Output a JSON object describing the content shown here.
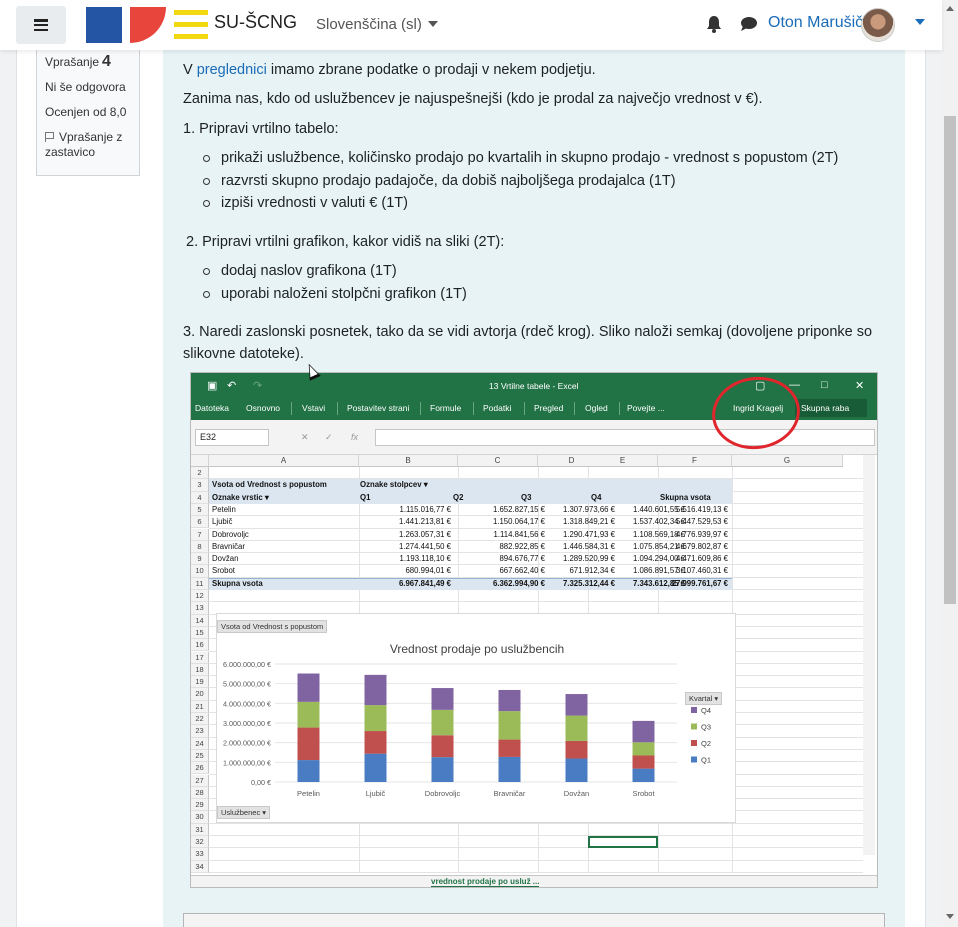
{
  "navbar": {
    "site_name": "SU-ŠCNG",
    "language": "Slovenščina (sl)",
    "user_name": "Oton Marušič"
  },
  "question_info": {
    "label": "Vprašanje",
    "number": "4",
    "status": "Ni še odgovora",
    "grade": "Ocenjen od 8,0",
    "flag_label": "Vprašanje z zastavico"
  },
  "question": {
    "intro_before_link": "V ",
    "intro_link": "preglednici",
    "intro_after_link": " imamo zbrane podatke o prodaji v nekem podjetju.",
    "line2": "Zanima nas, kdo od uslužbencev je najuspešnejši (kdo je prodal za največjo vrednost v €).",
    "task1": "1. Pripravi vrtilno tabelo:",
    "task1_items": [
      "prikaži uslužbence, količinsko prodajo po kvartalih in skupno prodajo - vrednost s popustom (2T)",
      "razvrsti skupno prodajo padajoče, da dobiš najboljšega prodajalca (1T)",
      "izpiši vrednosti v valuti € (1T)"
    ],
    "task2": "2. Pripravi vrtilni grafikon, kakor vidiš na sliki (2T):",
    "task2_items": [
      "dodaj naslov grafikona (1T)",
      "uporabi naloženi stolpčni grafikon (1T)"
    ],
    "task3": "3. Naredi zaslonski posnetek, tako da se vidi avtorja (rdeč krog). Sliko naloži semkaj (dovoljene priponke so slikovne datoteke)."
  },
  "excel": {
    "window_title": "13 Vrtilne tabele - Excel",
    "ribbon": [
      "Datoteka",
      "Osnovno",
      "Vstavi",
      "Postavitev strani",
      "Formule",
      "Podatki",
      "Pregled",
      "Ogled",
      "Povejte ..."
    ],
    "author": "Ingrid Kragelj",
    "share": "Skupna raba",
    "name_box": "E32",
    "columns": [
      "A",
      "B",
      "C",
      "D",
      "E",
      "F",
      "G"
    ],
    "rows": [
      "2",
      "3",
      "4",
      "5",
      "6",
      "7",
      "8",
      "9",
      "10",
      "11",
      "12",
      "13",
      "14",
      "15",
      "16",
      "17",
      "18",
      "19",
      "20",
      "21",
      "22",
      "23",
      "24",
      "25",
      "26",
      "27",
      "28",
      "29",
      "30",
      "31",
      "32",
      "33",
      "34"
    ],
    "pivot_title": "Vsota od Vrednost s popustom",
    "col_labels": "Oznake stolpcev",
    "row_labels": "Oznake vrstic",
    "quarters": [
      "Q1",
      "Q2",
      "Q3",
      "Q4"
    ],
    "total_header": "Skupna vsota",
    "table": [
      {
        "name": "Petelin",
        "q1": "1.115.016,77 €",
        "q2": "1.652.827,15 €",
        "q3": "1.307.973,66 €",
        "q4": "1.440.601,55 €",
        "total": "5.516.419,13 €"
      },
      {
        "name": "Ljubič",
        "q1": "1.441.213,81 €",
        "q2": "1.150.064,17 €",
        "q3": "1.318.849,21 €",
        "q4": "1.537.402,34 €",
        "total": "5.447.529,53 €"
      },
      {
        "name": "Dobrovoljc",
        "q1": "1.263.057,31 €",
        "q2": "1.114.841,56 €",
        "q3": "1.290.471,93 €",
        "q4": "1.108.569,18 €",
        "total": "4.776.939,97 €"
      },
      {
        "name": "Bravničar",
        "q1": "1.274.441,50 €",
        "q2": "882.922,85 €",
        "q3": "1.446.584,31 €",
        "q4": "1.075.854,21 €",
        "total": "4.679.802,87 €"
      },
      {
        "name": "Dovžan",
        "q1": "1.193.118,10 €",
        "q2": "894.676,77 €",
        "q3": "1.289.520,99 €",
        "q4": "1.094.294,00 €",
        "total": "4.471.609,86 €"
      },
      {
        "name": "Srobot",
        "q1": "680.994,01 €",
        "q2": "667.662,40 €",
        "q3": "671.912,34 €",
        "q4": "1.086.891,57 €",
        "total": "3.107.460,31 €"
      }
    ],
    "grand_total": {
      "name": "Skupna vsota",
      "q1": "6.967.841,49 €",
      "q2": "6.362.994,90 €",
      "q3": "7.325.312,44 €",
      "q4": "7.343.612,85 €",
      "total": "27.999.761,67 €"
    },
    "sheet_tab": "vrednost prodaje po usluž ..."
  },
  "chart_data": {
    "type": "bar",
    "stacked": true,
    "title": "Vrednost prodaje po uslužbencih",
    "field_button": "Vsota od Vrednost s popustom",
    "axis_button": "Uslužbenec",
    "legend_title": "Kvartal",
    "legend_position": "right",
    "categories": [
      "Petelin",
      "Ljubič",
      "Dobrovoljc",
      "Bravničar",
      "Dovžan",
      "Srobot"
    ],
    "y_ticks": [
      "0,00 €",
      "1.000.000,00 €",
      "2.000.000,00 €",
      "3.000.000,00 €",
      "4.000.000,00 €",
      "5.000.000,00 €",
      "6.000.000,00 €"
    ],
    "ylim": [
      0,
      6000000
    ],
    "series": [
      {
        "name": "Q1",
        "color": "#4a7cc4",
        "values": [
          1115016.77,
          1441213.81,
          1263057.31,
          1274441.5,
          1193118.1,
          680994.01
        ]
      },
      {
        "name": "Q2",
        "color": "#c0504d",
        "values": [
          1652827.15,
          1150064.17,
          1114841.56,
          882922.85,
          894676.77,
          667662.4
        ]
      },
      {
        "name": "Q3",
        "color": "#9bbb59",
        "values": [
          1307973.66,
          1318849.21,
          1290471.93,
          1446584.31,
          1289520.99,
          671912.34
        ]
      },
      {
        "name": "Q4",
        "color": "#8064a2",
        "values": [
          1440601.55,
          1537402.34,
          1108569.18,
          1075854.21,
          1094294.0,
          1086891.57
        ]
      }
    ]
  }
}
